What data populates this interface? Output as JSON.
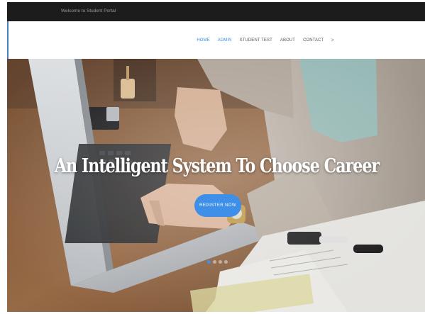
{
  "topbar": {
    "welcome": "Welcome to Student Portal"
  },
  "nav": {
    "items": [
      {
        "label": "HOME",
        "active": true
      },
      {
        "label": "ADMIN",
        "active": true
      },
      {
        "label": "STUDENT TEST",
        "active": false
      },
      {
        "label": "ABOUT",
        "active": false
      },
      {
        "label": "CONTACT",
        "active": false
      }
    ],
    "more": ">"
  },
  "hero": {
    "title": "An Intelligent System To Choose Career",
    "button": "REGISTER NOW",
    "slides": 4,
    "active_slide": 1
  },
  "colors": {
    "accent": "#3d8fe8",
    "topbar": "#1c1c1c",
    "nav_active": "#3a8fd8"
  }
}
